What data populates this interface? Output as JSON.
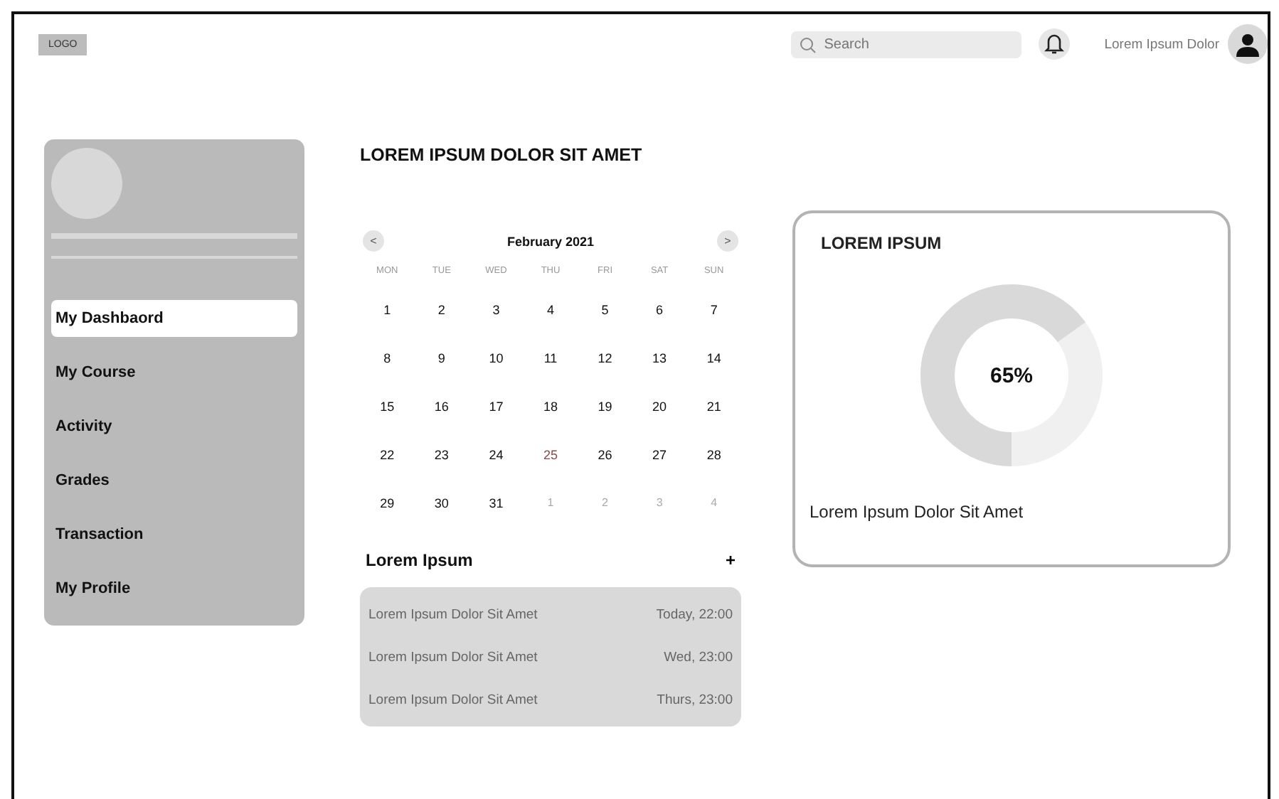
{
  "header": {
    "logo": "LOGO",
    "search": {
      "placeholder": "Search"
    },
    "user_name": "Lorem Ipsum Dolor"
  },
  "sidebar": {
    "items": [
      {
        "label": "My Dashbaord",
        "selected": true
      },
      {
        "label": "My Course",
        "selected": false
      },
      {
        "label": "Activity",
        "selected": false
      },
      {
        "label": "Grades",
        "selected": false
      },
      {
        "label": "Transaction",
        "selected": false
      },
      {
        "label": "My Profile",
        "selected": false
      }
    ]
  },
  "page_title": "LOREM IPSUM DOLOR SIT AMET",
  "calendar": {
    "prev": "<",
    "month": "February 2021",
    "next": ">",
    "weekdays": [
      "MON",
      "TUE",
      "WED",
      "THU",
      "FRI",
      "SAT",
      "SUN"
    ],
    "days": [
      {
        "day": "1",
        "kind": "current"
      },
      {
        "day": "2",
        "kind": "current"
      },
      {
        "day": "3",
        "kind": "current"
      },
      {
        "day": "4",
        "kind": "current"
      },
      {
        "day": "5",
        "kind": "current"
      },
      {
        "day": "6",
        "kind": "current"
      },
      {
        "day": "7",
        "kind": "current"
      },
      {
        "day": "8",
        "kind": "current"
      },
      {
        "day": "9",
        "kind": "current"
      },
      {
        "day": "10",
        "kind": "current"
      },
      {
        "day": "11",
        "kind": "current"
      },
      {
        "day": "12",
        "kind": "current"
      },
      {
        "day": "13",
        "kind": "current"
      },
      {
        "day": "14",
        "kind": "current"
      },
      {
        "day": "15",
        "kind": "current"
      },
      {
        "day": "16",
        "kind": "current"
      },
      {
        "day": "17",
        "kind": "current"
      },
      {
        "day": "18",
        "kind": "current"
      },
      {
        "day": "19",
        "kind": "current"
      },
      {
        "day": "20",
        "kind": "current"
      },
      {
        "day": "21",
        "kind": "current"
      },
      {
        "day": "22",
        "kind": "current"
      },
      {
        "day": "23",
        "kind": "current"
      },
      {
        "day": "24",
        "kind": "current"
      },
      {
        "day": "25",
        "kind": "today"
      },
      {
        "day": "26",
        "kind": "current"
      },
      {
        "day": "27",
        "kind": "current"
      },
      {
        "day": "28",
        "kind": "current"
      },
      {
        "day": "29",
        "kind": "current"
      },
      {
        "day": "30",
        "kind": "current"
      },
      {
        "day": "31",
        "kind": "current"
      },
      {
        "day": "1",
        "kind": "other"
      },
      {
        "day": "2",
        "kind": "other"
      },
      {
        "day": "3",
        "kind": "other"
      },
      {
        "day": "4",
        "kind": "other"
      }
    ]
  },
  "events": {
    "title": "Lorem Ipsum",
    "add": "+",
    "items": [
      {
        "name": "Lorem Ipsum Dolor Sit Amet",
        "time": "Today, 22:00"
      },
      {
        "name": "Lorem Ipsum Dolor Sit Amet",
        "time": "Wed, 23:00"
      },
      {
        "name": "Lorem Ipsum Dolor Sit Amet",
        "time": "Thurs, 23:00"
      }
    ]
  },
  "progress_card": {
    "title": "LOREM IPSUM",
    "level": 0.65,
    "reading": "65%",
    "caption": "Lorem Ipsum Dolor Sit Amet"
  }
}
